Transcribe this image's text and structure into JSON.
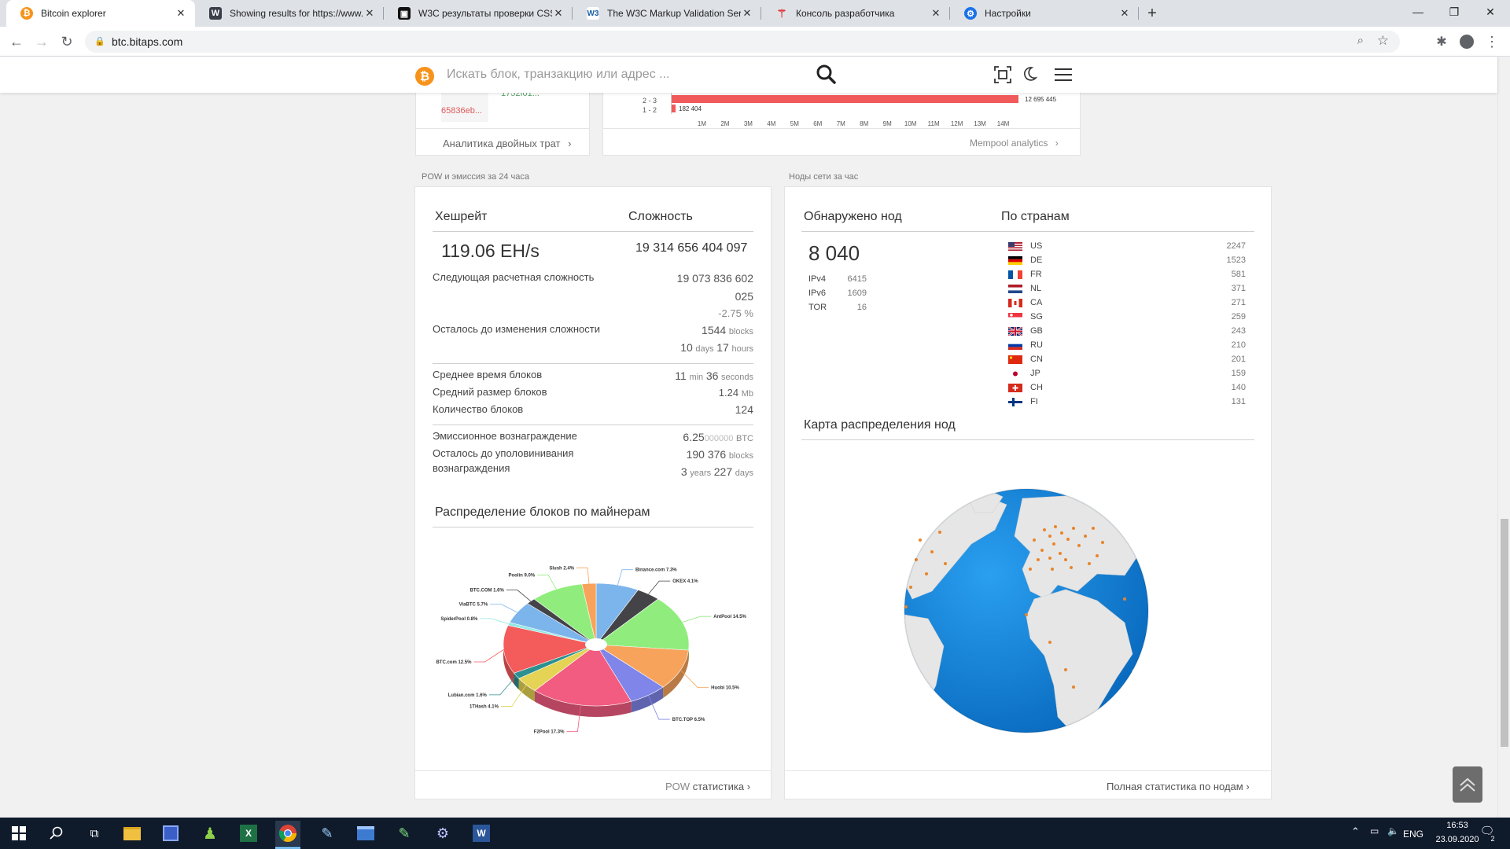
{
  "browser": {
    "tabs": [
      {
        "title": "Bitcoin explorer",
        "active": true,
        "icon": "bitcoin-favicon"
      },
      {
        "title": "Showing results for https://www...",
        "active": false,
        "icon": "wolf-favicon"
      },
      {
        "title": "W3C результаты проверки CSS",
        "active": false,
        "icon": "w3c-css-favicon"
      },
      {
        "title": "The W3C Markup Validation Serv",
        "active": false,
        "icon": "w3c-favicon"
      },
      {
        "title": "Консоль разработчика",
        "active": false,
        "icon": "api-favicon"
      },
      {
        "title": "Настройки",
        "active": false,
        "icon": "gear-favicon"
      }
    ],
    "url": "btc.bitaps.com"
  },
  "header": {
    "search_placeholder": "Искать блок, транзакцию или адрес ..."
  },
  "top_section": {
    "tx_hash_fragment": "65836eb...",
    "tx_hash_fragment2": "1752f01...",
    "double_spend_link": "Аналитика двойных трат",
    "mempool_link": "Mempool analytics",
    "bars": [
      {
        "label": "2 - 3",
        "value_text": "12 695 445",
        "value": 12695445
      },
      {
        "label": "1 - 2",
        "value_text": "182 404",
        "value": 182404
      }
    ],
    "axis_ticks": [
      "1M",
      "2M",
      "3M",
      "4M",
      "5M",
      "6M",
      "7M",
      "8M",
      "9M",
      "10M",
      "11M",
      "12M",
      "13M",
      "14M"
    ]
  },
  "pow": {
    "caption": "POW и эмиссия за 24 часа",
    "hashrate_title": "Хешрейт",
    "difficulty_title": "Сложность",
    "hashrate_value": "119.06 EH/s",
    "difficulty_value": "19 314 656 404 097",
    "next_diff_label": "Следующая расчетная сложность",
    "next_diff_value_1": "19 073 836 602",
    "next_diff_value_2": "025",
    "next_diff_change": "-2.75 %",
    "remaining_label": "Осталось до изменения сложности",
    "remaining_blocks": "1544",
    "remaining_blocks_unit": "blocks",
    "remaining_days": "10",
    "remaining_days_unit": "days",
    "remaining_hours": "17",
    "remaining_hours_unit": "hours",
    "avg_time_label": "Среднее время блоков",
    "avg_time_min": "11",
    "avg_time_min_unit": "min",
    "avg_time_sec": "36",
    "avg_time_sec_unit": "seconds",
    "avg_size_label": "Средний размер блоков",
    "avg_size_value": "1.24",
    "avg_size_unit": "Mb",
    "block_count_label": "Количество блоков",
    "block_count_value": "124",
    "reward_label": "Эмиссионное вознаграждение",
    "reward_value_main": "6.25",
    "reward_value_frac": "000000",
    "reward_unit": "BTC",
    "halving_label_1": "Осталось до уполовинивания",
    "halving_label_2": "вознаграждения",
    "halving_blocks": "190 376",
    "halving_blocks_unit": "blocks",
    "halving_years": "3",
    "halving_years_unit": "years",
    "halving_days": "227",
    "halving_days_unit": "days",
    "miners_title": "Распределение блоков по майнерам",
    "footer_prefix": "POW",
    "footer_link": "статистика"
  },
  "nodes": {
    "caption": "Ноды сети за час",
    "found_title": "Обнаружено нод",
    "countries_title": "По странам",
    "total": "8 040",
    "ipv4_label": "IPv4",
    "ipv4_value": "6415",
    "ipv6_label": "IPv6",
    "ipv6_value": "1609",
    "tor_label": "TOR",
    "tor_value": "16",
    "countries": [
      {
        "code": "US",
        "value": "2247"
      },
      {
        "code": "DE",
        "value": "1523"
      },
      {
        "code": "FR",
        "value": "581"
      },
      {
        "code": "NL",
        "value": "371"
      },
      {
        "code": "CA",
        "value": "271"
      },
      {
        "code": "SG",
        "value": "259"
      },
      {
        "code": "GB",
        "value": "243"
      },
      {
        "code": "RU",
        "value": "210"
      },
      {
        "code": "CN",
        "value": "201"
      },
      {
        "code": "JP",
        "value": "159"
      },
      {
        "code": "CH",
        "value": "140"
      },
      {
        "code": "FI",
        "value": "131"
      }
    ],
    "map_title": "Карта распределения нод",
    "footer_link": "Полная статистика по нодам"
  },
  "chart_data": {
    "type": "pie",
    "title": "Распределение блоков по майнерам",
    "slices": [
      {
        "label": "Binance.com 7.3%",
        "value": 7.3,
        "color": "#7cb5ec"
      },
      {
        "label": "OKEX 4.1%",
        "value": 4.1,
        "color": "#434348"
      },
      {
        "label": "AntPool 14.5%",
        "value": 14.5,
        "color": "#90ed7d"
      },
      {
        "label": "Huobi 10.5%",
        "value": 10.5,
        "color": "#f7a35c"
      },
      {
        "label": "BTC.TOP 6.5%",
        "value": 6.5,
        "color": "#8085e9"
      },
      {
        "label": "F2Pool 17.3%",
        "value": 17.3,
        "color": "#f15c80"
      },
      {
        "label": "1THash 4.1%",
        "value": 4.1,
        "color": "#e4d354"
      },
      {
        "label": "Lubian.com 1.6%",
        "value": 1.6,
        "color": "#2b908f"
      },
      {
        "label": "BTC.com 12.5%",
        "value": 12.5,
        "color": "#f45b5b"
      },
      {
        "label": "SpiderPool 0.8%",
        "value": 0.8,
        "color": "#91e8e1"
      },
      {
        "label": "ViaBTC 5.7%",
        "value": 5.7,
        "color": "#7cb5ec"
      },
      {
        "label": "BTC.COM 1.6%",
        "value": 1.6,
        "color": "#434348"
      },
      {
        "label": "Poolin 9.0%",
        "value": 9.0,
        "color": "#90ed7d"
      },
      {
        "label": "Slush 2.4%",
        "value": 2.4,
        "color": "#f7a35c"
      }
    ]
  },
  "taskbar": {
    "lang": "ENG",
    "time": "16:53",
    "date": "23.09.2020",
    "notif_count": "2"
  }
}
